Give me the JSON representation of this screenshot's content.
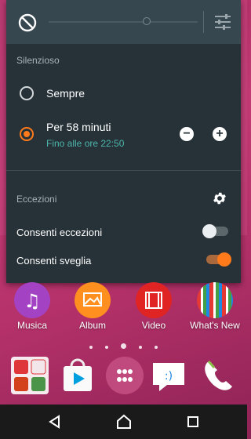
{
  "panel": {
    "section_silent": "Silenzioso",
    "options": [
      {
        "label": "Sempre",
        "selected": false
      },
      {
        "label": "Per 58 minuti",
        "sub": "Fino alle ore 22:50",
        "selected": true
      }
    ],
    "section_exceptions": "Eccezioni",
    "toggles": [
      {
        "label": "Consenti eccezioni",
        "on": false
      },
      {
        "label": "Consenti sveglia",
        "on": true
      }
    ]
  },
  "home": {
    "apps": [
      "Musica",
      "Album",
      "Video",
      "What's New"
    ],
    "page_count": 5,
    "active_page": 2
  },
  "colors": {
    "accent": "#ff7a1a",
    "subtext": "#4db6ac",
    "panel_bg": "#263238"
  }
}
